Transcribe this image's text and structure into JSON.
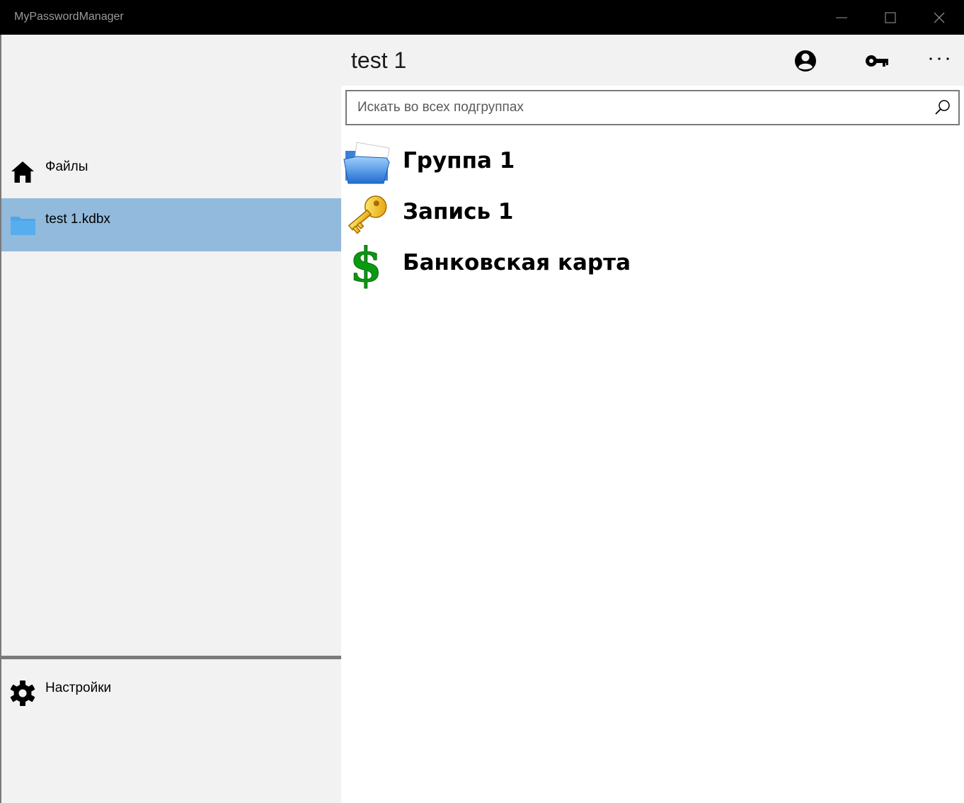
{
  "window": {
    "title": "MyPasswordManager",
    "controls": [
      "minimize",
      "maximize",
      "close"
    ]
  },
  "sidebar": {
    "items": [
      {
        "label": "Файлы",
        "icon": "home-icon"
      },
      {
        "label": "test 1.kdbx",
        "icon": "folder-icon",
        "selected": true
      }
    ],
    "footer": {
      "label": "Настройки",
      "icon": "gear-icon"
    }
  },
  "header": {
    "title": "test 1",
    "actions": [
      "user-icon",
      "key-icon",
      "more-icon"
    ]
  },
  "search": {
    "placeholder": "Искать во всех подгруппах",
    "value": ""
  },
  "entries": [
    {
      "name": "Группа 1",
      "icon": "open-folder-icon"
    },
    {
      "name": "Запись 1",
      "icon": "key-icon"
    },
    {
      "name": "Банковская карта",
      "icon": "dollar-icon"
    }
  ],
  "colors": {
    "titlebar": "#000000",
    "sidebar_bg": "#f2f2f2",
    "selected_bg": "#92badc",
    "content_bg": "#ffffff"
  }
}
